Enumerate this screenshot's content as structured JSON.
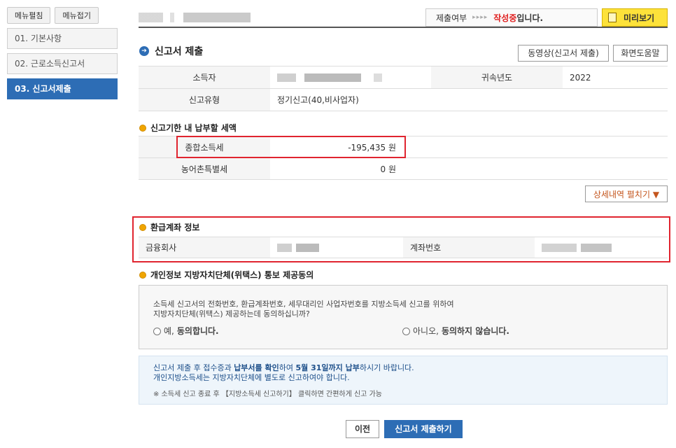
{
  "sidebar": {
    "expand_label": "메뉴펼침",
    "collapse_label": "메뉴접기",
    "items": [
      {
        "label": "01. 기본사항"
      },
      {
        "label": "02. 근로소득신고서"
      },
      {
        "label": "03. 신고서제출"
      }
    ]
  },
  "topbar": {
    "status_label": "제출여부",
    "status_arrows": "▸▸▸▸",
    "status_state": "작성중",
    "status_suffix": "입니다.",
    "preview_label": "미리보기"
  },
  "section": {
    "title": "신고서 제출",
    "video_button": "동영상(신고서 제출)",
    "help_button": "화면도움말"
  },
  "info": {
    "earner_label": "소득자",
    "year_label": "귀속년도",
    "year_value": "2022",
    "type_label": "신고유형",
    "type_value": "정기신고(40,비사업자)"
  },
  "tax": {
    "title": "신고기한 내 납부할 세액",
    "rows": [
      {
        "label": "종합소득세",
        "value": "-195,435 원"
      },
      {
        "label": "농어촌특별세",
        "value": "0 원"
      }
    ],
    "detail_button": "상세내역 펼치기 ▼"
  },
  "refund": {
    "title": "환급계좌 정보",
    "bank_label": "금융회사",
    "account_label": "계좌번호"
  },
  "consent": {
    "title": "개인정보 지방자치단체(위택스) 통보 제공동의",
    "question_line1": "소득세 신고서의 전화번호, 환급계좌번호, 세무대리인 사업자번호를 지방소득세 신고를 위하여",
    "question_line2": "지방자치단체(위택스) 제공하는데 동의하십니까?",
    "yes_prefix": "예, ",
    "yes_bold": "동의합니다.",
    "no_prefix": "아니오, ",
    "no_bold": "동의하지 않습니다."
  },
  "notice": {
    "line1_a": "신고서 제출 후 접수증과 ",
    "line1_b": "납부서를 확인",
    "line1_c": "하여 ",
    "line1_d": "5월 31일까지 납부",
    "line1_e": "하시기 바랍니다.",
    "line2": "개인지방소득세는 지방자치단체에 별도로 신고하여야 합니다.",
    "line3": "※ 소득세 신고 종료 후 【지방소득세 신고하기】 클릭하면 간편하게 신고 가능"
  },
  "footer": {
    "prev_button": "이전",
    "submit_button": "신고서 제출하기"
  }
}
